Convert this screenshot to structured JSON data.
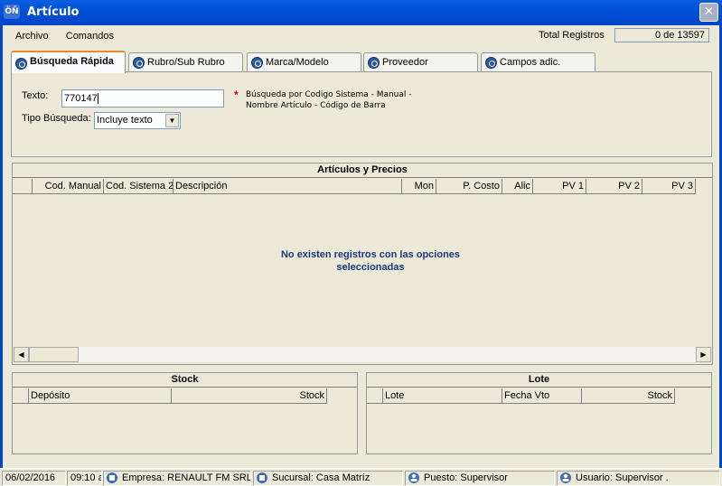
{
  "window": {
    "title": "Artículo",
    "close_glyph": "✕",
    "app_icon_text": "ÖÑ"
  },
  "menu": {
    "items": [
      "Archivo",
      "Comandos"
    ]
  },
  "total": {
    "label": "Total Registros",
    "value": "0 de 13597"
  },
  "tabs": [
    {
      "label": "Búsqueda Rápida",
      "active": true
    },
    {
      "label": "Rubro/Sub Rubro"
    },
    {
      "label": "Marca/Modelo"
    },
    {
      "label": "Proveedor"
    },
    {
      "label": "Campos adic."
    }
  ],
  "search": {
    "texto_label": "Texto:",
    "texto_value": "770147",
    "tipo_label": "Tipo Búsqueda:",
    "tipo_value": "Incluye texto",
    "asterisk": "*",
    "hint_line1": "Búsqueda por Codigo Sistema - Manual -",
    "hint_line2": "Nombre Artículo - Código de Barra"
  },
  "articles": {
    "title": "Artículos y Precios",
    "columns": [
      "Cod. Manual",
      "Cod. Sistema 2",
      "Descripción",
      "Mon",
      "P. Costo",
      "Alic",
      "PV 1",
      "PV 2",
      "PV 3"
    ],
    "empty_line1": "No existen registros con las opciones",
    "empty_line2": "seleccionadas"
  },
  "stock": {
    "title": "Stock",
    "columns": [
      "Depósito",
      "Stock"
    ]
  },
  "lote": {
    "title": "Lote",
    "columns": [
      "Lote",
      "Fecha Vto",
      "Stock"
    ]
  },
  "status": {
    "date": "06/02/2016",
    "time": "09:10 a",
    "empresa": "Empresa: RENAULT FM SRL",
    "sucursal": "Sucursal: Casa Matríz",
    "puesto": "Puesto: Supervisor",
    "usuario": "Usuario: Supervisor ."
  },
  "colors": {
    "title_bar": "#0050d8",
    "empty_text": "#1a3a7a",
    "asterisk": "#d00000",
    "active_tab_top": "#e68b2c"
  }
}
